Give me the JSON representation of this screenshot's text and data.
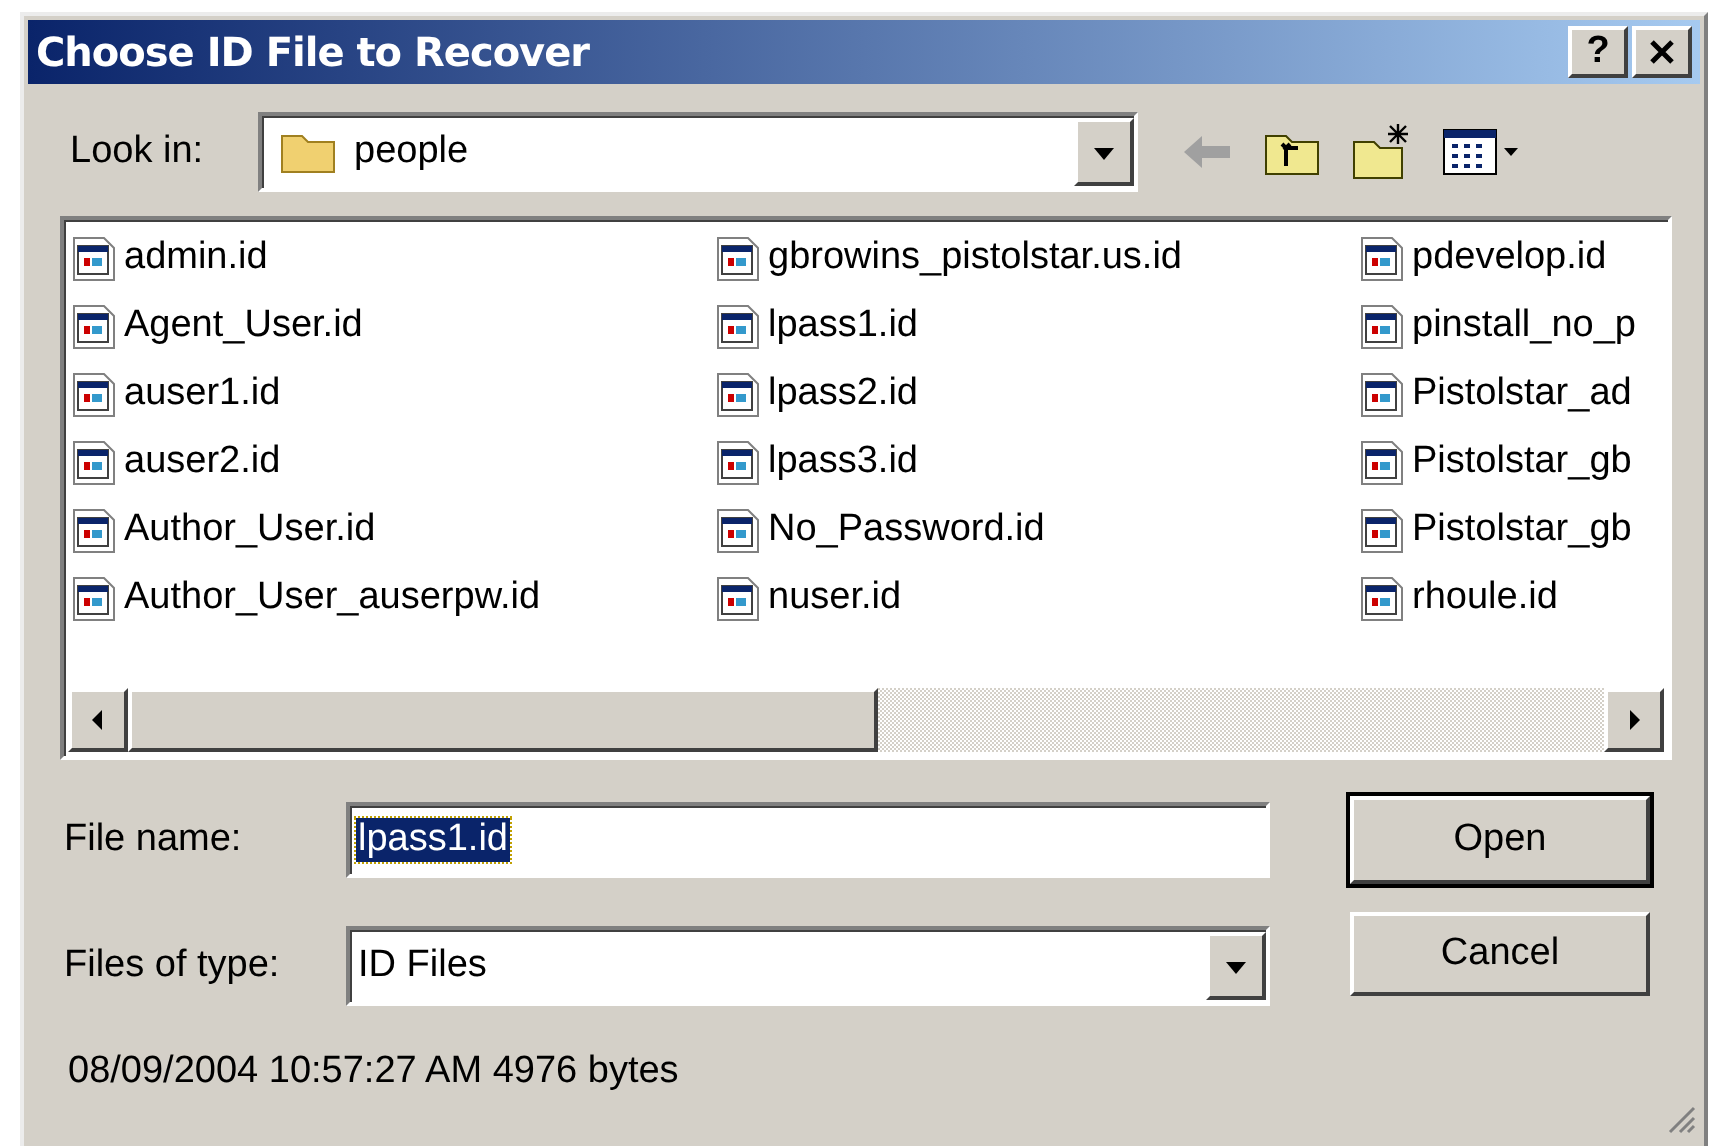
{
  "window": {
    "title": "Choose ID File to Recover",
    "help_button": "?"
  },
  "look_in": {
    "label": "Look in:",
    "value": "people"
  },
  "files": [
    {
      "name": "admin.id",
      "selected": false
    },
    {
      "name": "Agent_User.id",
      "selected": false
    },
    {
      "name": "auser1.id",
      "selected": false
    },
    {
      "name": "auser2.id",
      "selected": false
    },
    {
      "name": "Author_User.id",
      "selected": false
    },
    {
      "name": "Author_User_auserpw.id",
      "selected": false
    },
    {
      "name": "gbrowins_pistolstar.us.id",
      "selected": false
    },
    {
      "name": "lpass1.id",
      "selected": false
    },
    {
      "name": "lpass2.id",
      "selected": false
    },
    {
      "name": "lpass3.id",
      "selected": false
    },
    {
      "name": "No_Password.id",
      "selected": false
    },
    {
      "name": "nuser.id",
      "selected": false
    },
    {
      "name": "pdevelop.id",
      "selected": false
    },
    {
      "name": "pinstall_no_p",
      "selected": false
    },
    {
      "name": "Pistolstar_ad",
      "selected": false
    },
    {
      "name": "Pistolstar_gb",
      "selected": false
    },
    {
      "name": "Pistolstar_gb",
      "selected": false
    },
    {
      "name": "rhoule.id",
      "selected": false
    }
  ],
  "file_name": {
    "label": "File name:",
    "value": "lpass1.id",
    "text_selected": true
  },
  "file_type": {
    "label": "Files of type:",
    "value": "ID Files"
  },
  "buttons": [
    {
      "label": "Open",
      "default": true
    },
    {
      "label": "Cancel",
      "default": false
    }
  ],
  "status": "08/09/2004 10:57:27 AM 4976 bytes"
}
